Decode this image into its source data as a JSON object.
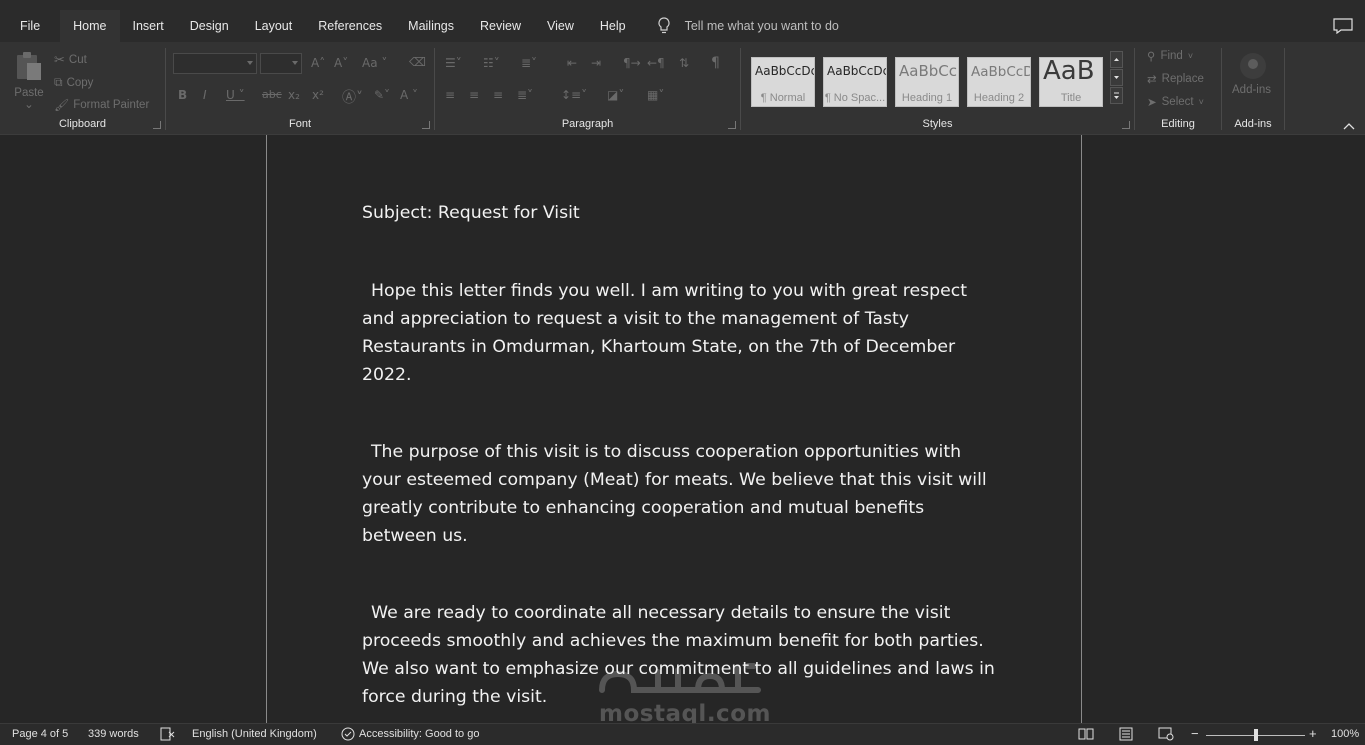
{
  "menu": {
    "tabs": [
      "File",
      "Home",
      "Insert",
      "Design",
      "Layout",
      "References",
      "Mailings",
      "Review",
      "View",
      "Help"
    ],
    "active_tab": "Home",
    "tell_me": "Tell me what you want to do"
  },
  "ribbon": {
    "clipboard": {
      "label": "Clipboard",
      "paste": "Paste",
      "cut": "Cut",
      "copy": "Copy",
      "format_painter": "Format Painter"
    },
    "font": {
      "label": "Font"
    },
    "paragraph": {
      "label": "Paragraph"
    },
    "styles": {
      "label": "Styles",
      "items": [
        {
          "sample": "AaBbCcDc",
          "name": "¶ Normal"
        },
        {
          "sample": "AaBbCcDc",
          "name": "¶ No Spac..."
        },
        {
          "sample": "AaBbCc",
          "name": "Heading 1"
        },
        {
          "sample": "AaBbCcD",
          "name": "Heading 2"
        },
        {
          "sample": "AaB",
          "name": "Title"
        }
      ]
    },
    "editing": {
      "label": "Editing",
      "find": "Find",
      "replace": "Replace",
      "select": "Select"
    },
    "addins": {
      "label": "Add-ins",
      "button": "Add-ins"
    }
  },
  "document": {
    "subject": "Subject: Request for Visit",
    "paragraphs": [
      "Hope this letter finds you well. I am writing to you with great respect and appreciation to request a visit to the management of Tasty Restaurants in Omdurman, Khartoum State, on the 7th of December 2022.",
      "The purpose of this visit is to discuss cooperation opportunities with your esteemed company (Meat) for meats. We believe that this visit will greatly contribute to enhancing cooperation and mutual benefits between us.",
      "We are ready to coordinate all necessary details to ensure the visit proceeds smoothly and achieves the maximum benefit for both parties. We also want to emphasize our commitment to all guidelines and laws in force during the visit."
    ]
  },
  "watermark": {
    "text": "mostaql.com"
  },
  "status": {
    "page": "Page 4 of 5",
    "words": "339 words",
    "language": "English (United Kingdom)",
    "accessibility": "Accessibility: Good to go",
    "zoom": "100%",
    "zoom_level": 1.0
  }
}
